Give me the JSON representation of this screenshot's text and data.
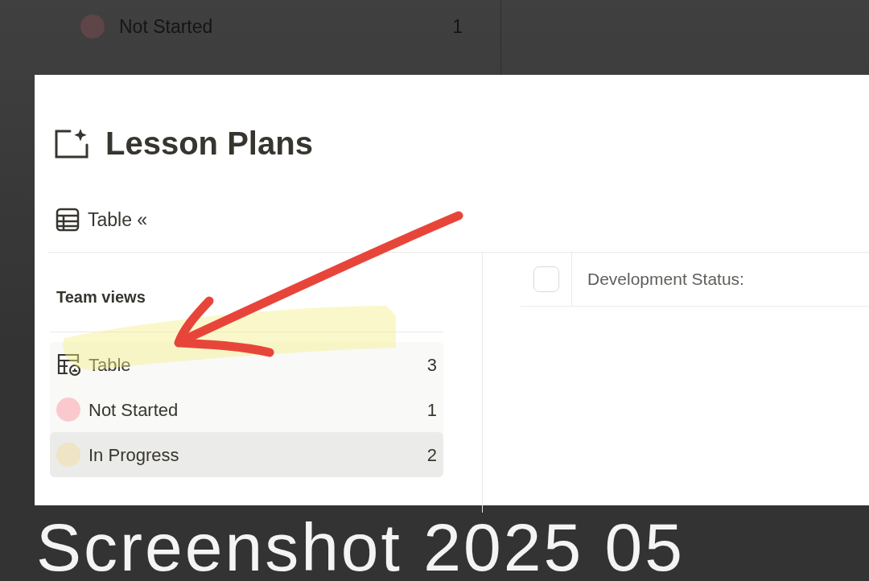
{
  "background_list": [
    {
      "label": "Not Started",
      "count": "1",
      "color": "#5e4547"
    }
  ],
  "page": {
    "title": "Lesson Plans",
    "view_tab": {
      "label": "Table",
      "collapse": "«"
    }
  },
  "sidebar": {
    "heading": "Team views",
    "items": [
      {
        "kind": "view",
        "label": "Table",
        "count": "3",
        "selected": false
      },
      {
        "kind": "status",
        "label": "Not Started",
        "count": "1",
        "color": "#fbc9cd",
        "selected": false
      },
      {
        "kind": "status",
        "label": "In Progress",
        "count": "2",
        "color": "#efe4c3",
        "selected": true
      }
    ]
  },
  "table": {
    "columns": [
      "Development Status:"
    ],
    "checked": false
  },
  "captions": [
    {
      "text": "Screenshot 2025 05",
      "kind": "front"
    }
  ]
}
